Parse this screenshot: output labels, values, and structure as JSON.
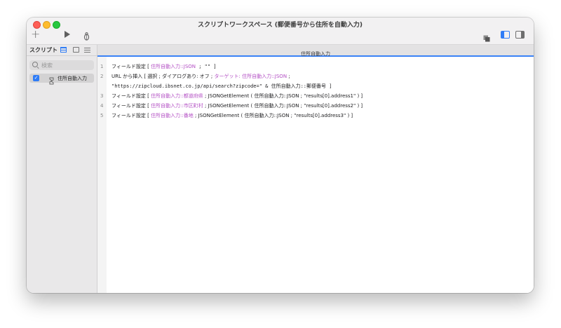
{
  "window": {
    "title": "スクリプトワークスペース (郵便番号から住所を自動入力)"
  },
  "toolbar": {
    "new_icon": "plus-icon",
    "run_icon": "play-icon",
    "debug_icon": "bug-icon",
    "right_icons": [
      "layers-icon",
      "sidebar-left-icon",
      "sidebar-right-icon"
    ]
  },
  "sidebar": {
    "title": "スクリプト",
    "search_placeholder": "検索",
    "items": [
      {
        "label": "住所自動入力",
        "checked": true
      }
    ]
  },
  "editor": {
    "tab_label": "住所自動入力",
    "lines": [
      {
        "num": "1",
        "parts": [
          "フィールド設定 [ ",
          "住所自動入力::JSON",
          " ; \"\" ]"
        ]
      },
      {
        "num": "2",
        "parts": [
          "URL から挿入 [ 選択 ; ダイアログあり: オフ ; ",
          "ターゲット: 住所自動入力::JSON",
          " ;"
        ],
        "continuation": "\"https://zipcloud.ibsnet.co.jp/api/search?zipcode=\" & 住所自動入力::郵便番号 ]"
      },
      {
        "num": "3",
        "parts": [
          "フィールド設定 [ ",
          "住所自動入力::都道府県",
          " ; JSONGetElement ( 住所自動入力::JSON ; \"results[0].address1\" ) ]"
        ]
      },
      {
        "num": "4",
        "parts": [
          "フィールド設定 [ ",
          "住所自動入力::市区町村",
          " ; JSONGetElement ( 住所自動入力::JSON ; \"results[0].address2\" ) ]"
        ]
      },
      {
        "num": "5",
        "parts": [
          "フィールド設定 [ ",
          "住所自動入力::番地",
          " ; JSONGetElement ( 住所自動入力::JSON ; \"results[0].address3\" ) ]"
        ]
      }
    ]
  },
  "colors": {
    "field_ref": "#b34fc4",
    "accent": "#2f7cf6"
  }
}
